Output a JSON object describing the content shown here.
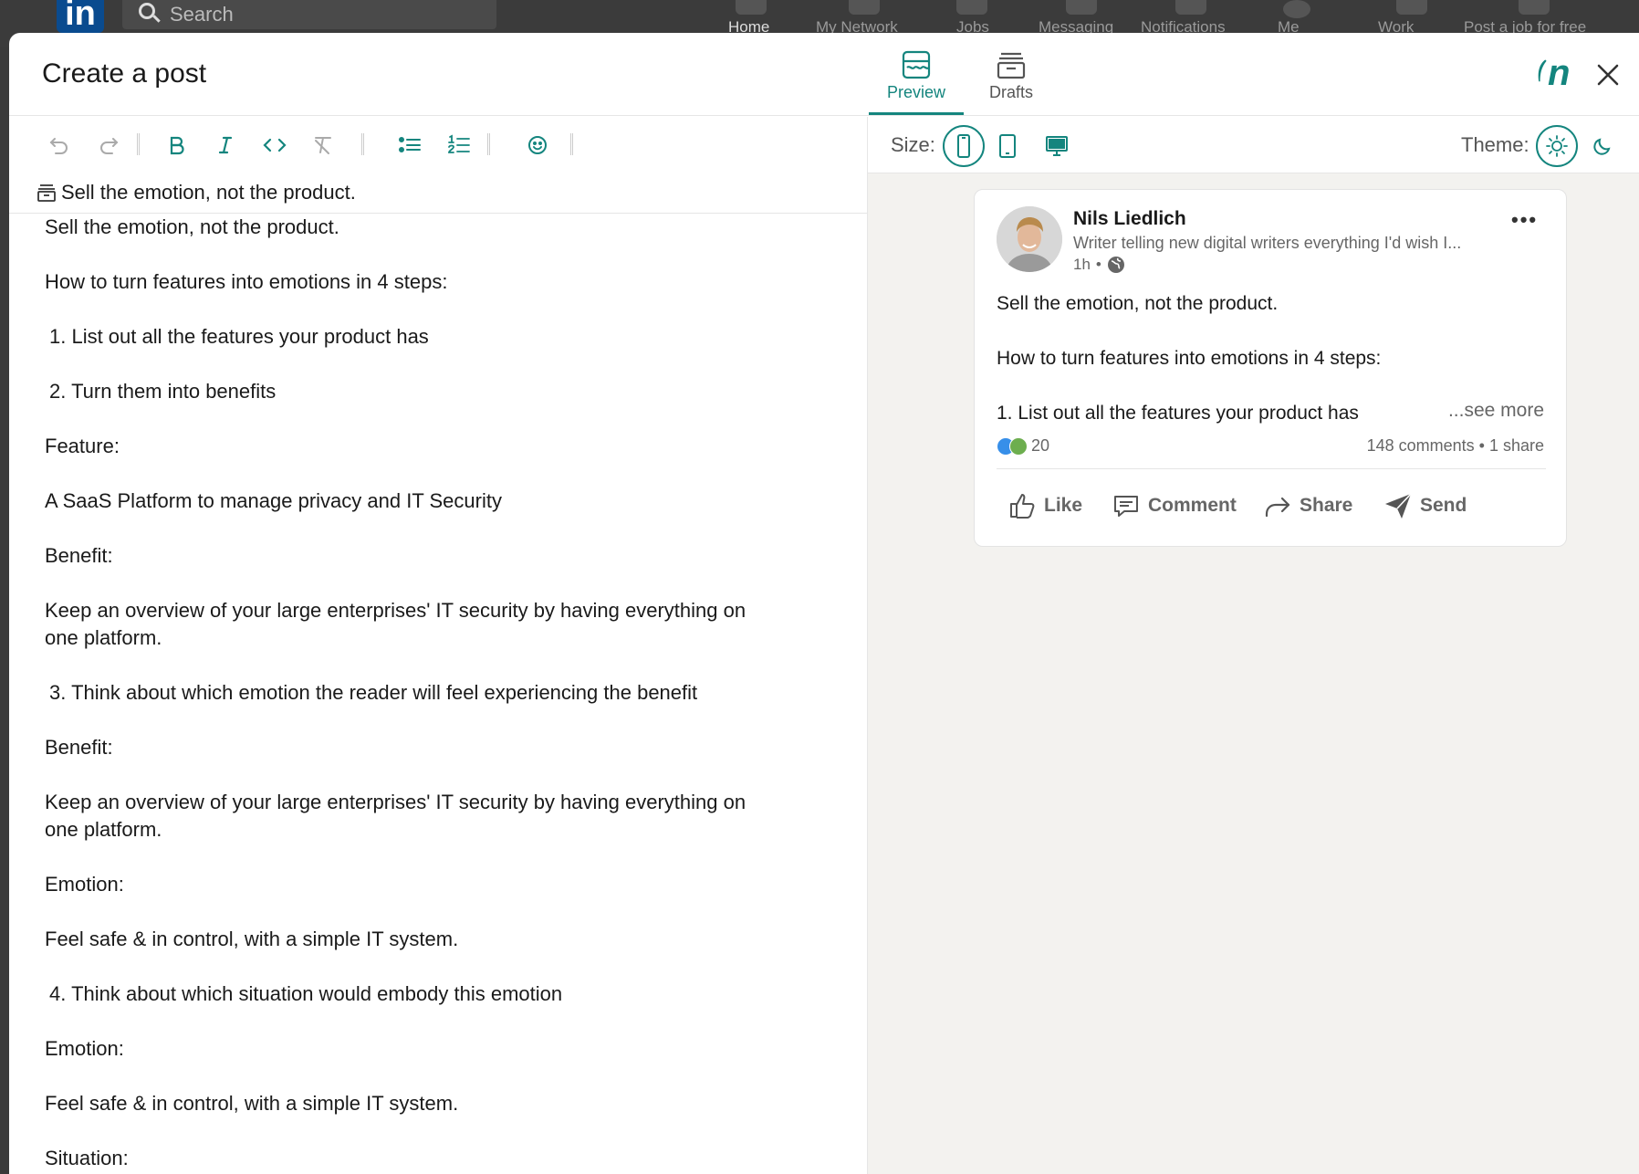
{
  "background_nav": {
    "logo": "in",
    "search_placeholder": "Search",
    "items": [
      "Home",
      "My Network",
      "Jobs",
      "Messaging",
      "Notifications",
      "Me",
      "Work",
      "Post a job for free"
    ]
  },
  "header": {
    "title": "Create a post",
    "tabs": [
      {
        "label": "Preview",
        "icon": "preview-icon",
        "active": true
      },
      {
        "label": "Drafts",
        "icon": "drafts-icon",
        "active": false
      }
    ],
    "brand": "n"
  },
  "toolbar": {
    "buttons": [
      "undo-icon",
      "redo-icon",
      "bold-icon",
      "italic-icon",
      "code-icon",
      "clear-format-icon",
      "bullet-list-icon",
      "numbered-list-icon",
      "emoji-icon"
    ]
  },
  "draft": {
    "title": "Sell the emotion, not the product."
  },
  "editor": {
    "lines": [
      "Sell the emotion, not the product.",
      "How to turn features into emotions in 4 steps:",
      " 1. List out all the features your product has",
      " 2. Turn them into benefits",
      "Feature:",
      "A SaaS Platform to manage privacy and IT Security",
      "Benefit:",
      "Keep an overview of your large enterprises' IT security by having everything on one platform.",
      " 3. Think about which emotion the reader will feel experiencing the benefit",
      "Benefit:",
      "Keep an overview of your large enterprises' IT security by having everything on one platform.",
      "Emotion:",
      "Feel safe & in control, with a simple IT system.",
      " 4. Think about which situation would embody this emotion",
      "Emotion:",
      "Feel safe & in control, with a simple IT system.",
      "Situation:"
    ]
  },
  "preview": {
    "size_label": "Size:",
    "sizes": [
      "mobile-icon",
      "tablet-icon",
      "desktop-icon"
    ],
    "active_size": "mobile",
    "theme_label": "Theme:",
    "themes": [
      "sun-icon",
      "moon-icon"
    ],
    "active_theme": "light",
    "post": {
      "author": "Nils Liedlich",
      "headline": "Writer telling new digital writers everything I'd wish I...",
      "time": "1h",
      "visibility_icon": "globe-icon",
      "body": [
        "Sell the emotion, not the product.",
        "How to turn features into emotions in 4 steps:",
        "1. List out all the features your product has"
      ],
      "see_more": "...see more",
      "reaction_count": "20",
      "social_counts": "148 comments • 1 share",
      "actions": [
        {
          "label": "Like",
          "icon": "like-icon"
        },
        {
          "label": "Comment",
          "icon": "comment-icon"
        },
        {
          "label": "Share",
          "icon": "share-icon"
        },
        {
          "label": "Send",
          "icon": "send-icon"
        }
      ]
    }
  },
  "colors": {
    "accent": "#14857e",
    "pane_bg": "#f3f2ef",
    "text": "#1a1a1a",
    "muted": "#666666"
  }
}
